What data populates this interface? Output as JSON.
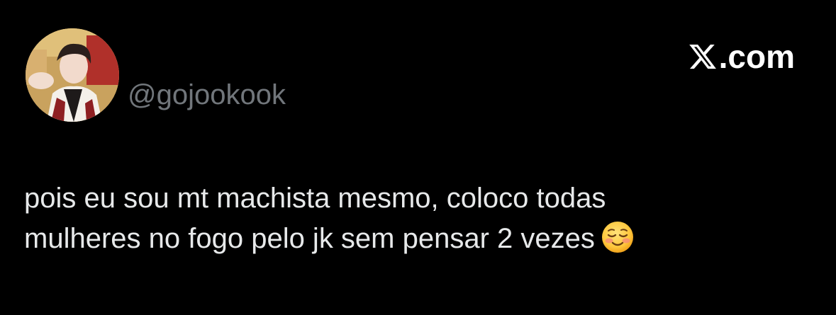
{
  "post": {
    "handle": "@gojookook",
    "text_lines": [
      "pois eu sou mt machista mesmo, coloco todas",
      "mulheres no fogo pelo jk sem pensar 2 vezes"
    ],
    "emoji": "smiling-face-icon"
  },
  "brand": {
    "logo": "x-logo-icon",
    "suffix": ".com"
  },
  "colors": {
    "background": "#000000",
    "text": "#e7e9ea",
    "handle": "#71767b",
    "brand": "#ffffff"
  }
}
